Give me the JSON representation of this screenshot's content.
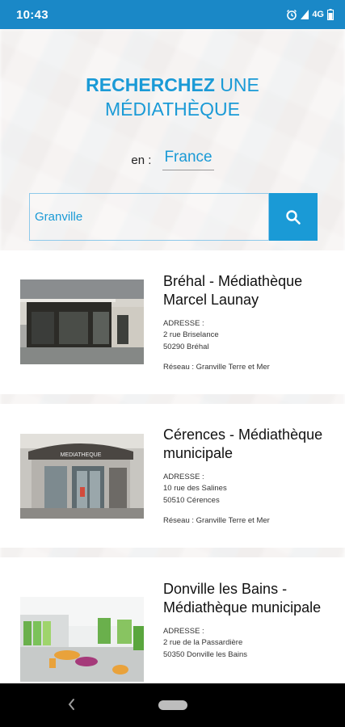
{
  "status_bar": {
    "time": "10:43",
    "network": "4G"
  },
  "hero": {
    "title_strong": "RECHERCHEZ",
    "title_rest": " UNE",
    "title_line2": "MÉDIATHÈQUE",
    "country_prefix": "en :",
    "country_value": "France"
  },
  "search": {
    "value": "Granville",
    "icon": "search-icon"
  },
  "results": [
    {
      "title": "Bréhal - Médiathèque Marcel Launay",
      "address_label": "ADRESSE :",
      "street": "2 rue Briselance",
      "city": "50290 Bréhal",
      "network": "Réseau : Granville Terre et Mer"
    },
    {
      "title": "Cérences - Médiathèque municipale",
      "address_label": "ADRESSE :",
      "street": "10 rue des Salines",
      "city": "50510 Cérences",
      "network": "Réseau : Granville Terre et Mer"
    },
    {
      "title": "Donville les Bains - Médiathèque municipale",
      "address_label": "ADRESSE :",
      "street": "2 rue de la Passardière",
      "city": "50350 Donville les Bains",
      "network": ""
    }
  ],
  "building_sign": "MEDIATHEQUE",
  "colors": {
    "accent": "#1a9ad6",
    "status_bar": "#1a88c7"
  }
}
